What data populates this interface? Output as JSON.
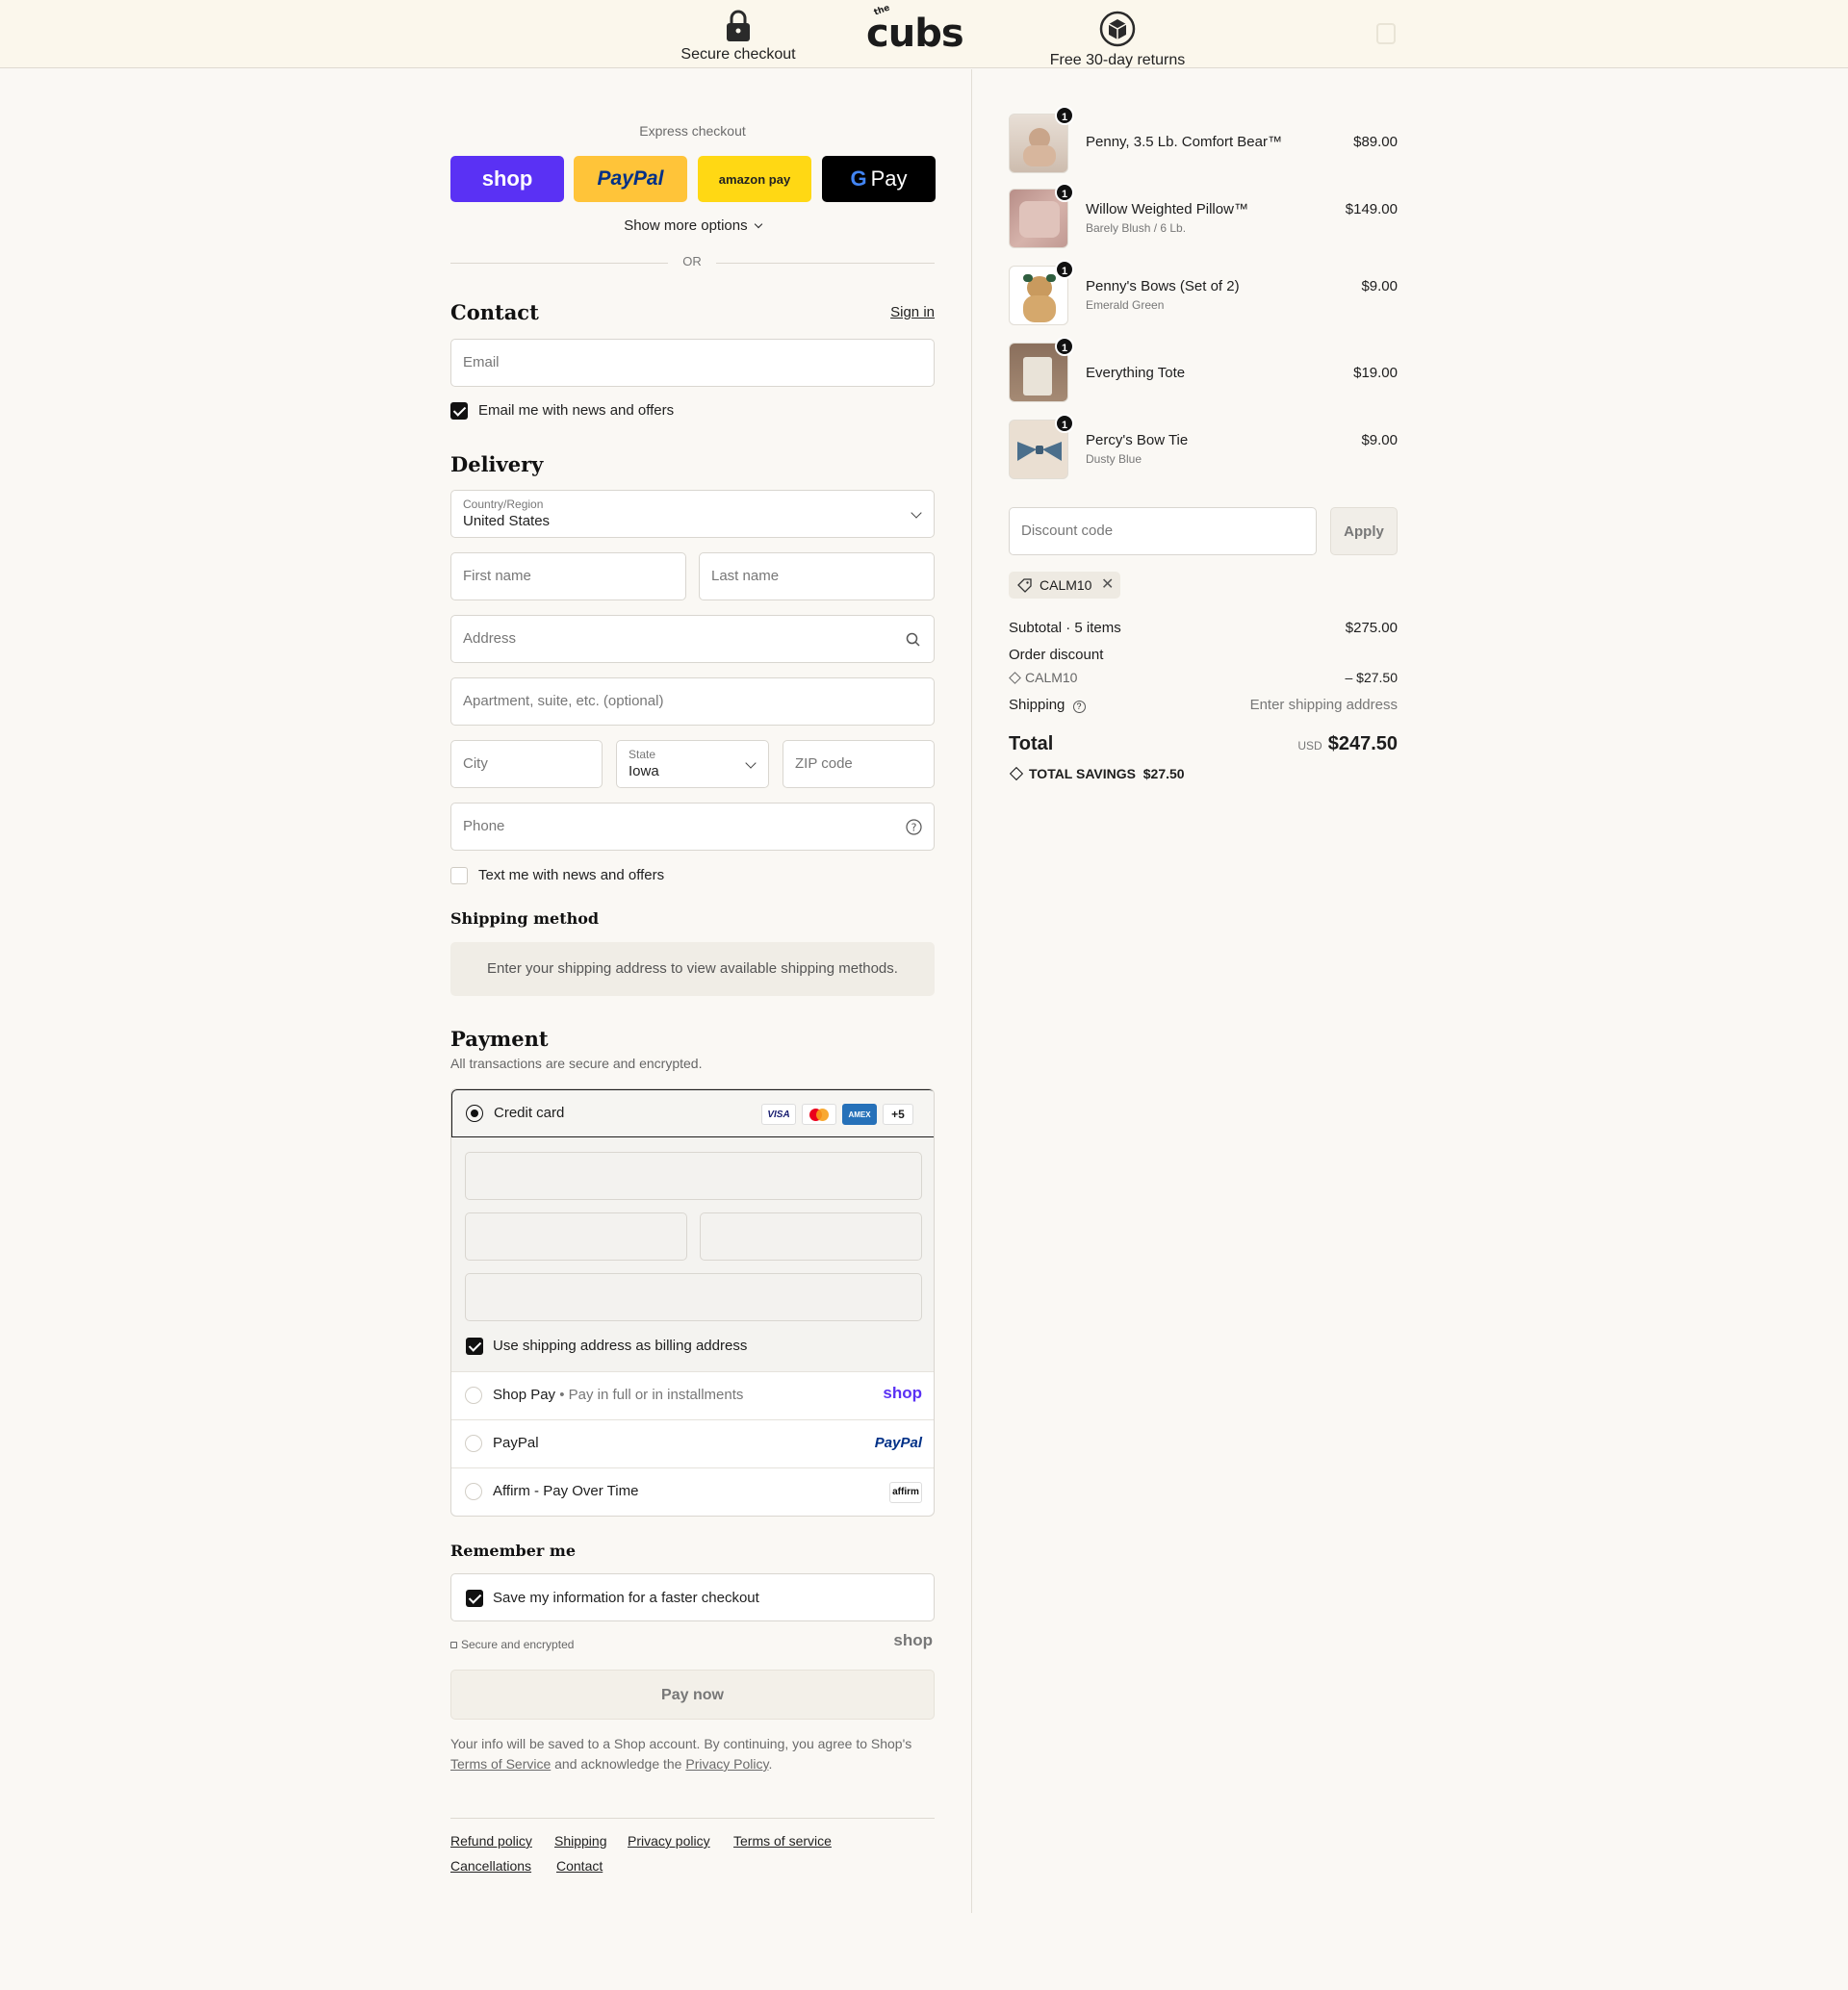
{
  "header": {
    "secure_label": "Secure checkout",
    "returns_label": "Free 30-day returns",
    "logo_text": "cubs",
    "logo_small": "the"
  },
  "express": {
    "title": "Express checkout",
    "shop_label": "shop",
    "paypal_label": "PayPal",
    "amazon_label": "amazon pay",
    "gpay_label": "Pay",
    "show_more": "Show more options",
    "or": "OR"
  },
  "contact": {
    "heading": "Contact",
    "sign_in": "Sign in",
    "email_placeholder": "Email",
    "news_label": "Email me with news and offers"
  },
  "delivery": {
    "heading": "Delivery",
    "country_label": "Country/Region",
    "country_value": "United States",
    "first_name": "First name",
    "last_name": "Last name",
    "address": "Address",
    "apartment": "Apartment, suite, etc. (optional)",
    "city": "City",
    "state_label": "State",
    "state_value": "Iowa",
    "zip": "ZIP code",
    "phone": "Phone",
    "text_label": "Text me with news and offers"
  },
  "shipping_method": {
    "heading": "Shipping method",
    "notice": "Enter your shipping address to view available shipping methods."
  },
  "payment": {
    "heading": "Payment",
    "subtitle": "All transactions are secure and encrypted.",
    "credit_card": "Credit card",
    "card_badges": [
      "VISA",
      "",
      "AMEX",
      "+5"
    ],
    "billing_label": "Use shipping address as billing address",
    "shop_pay": "Shop Pay",
    "shop_pay_sub": "Pay in full or in installments",
    "shop_pay_logo": "shop",
    "paypal": "PayPal",
    "paypal_logo": "PayPal",
    "affirm": "Affirm - Pay Over Time",
    "affirm_logo": "affirm"
  },
  "remember": {
    "heading": "Remember me",
    "save_label": "Save my information for a faster checkout",
    "secure_note": "Secure and encrypted",
    "shop_logo": "shop"
  },
  "paynow": "Pay now",
  "legal": {
    "prefix": "Your info will be saved to a Shop account. By continuing, you agree to Shop's ",
    "tos": "Terms of Service",
    "middle": " and acknowledge the ",
    "privacy": "Privacy Policy",
    "suffix": "."
  },
  "footer_links": [
    "Refund policy",
    "Shipping",
    "Privacy policy",
    "Terms of service",
    "Cancellations",
    "Contact"
  ],
  "cart": {
    "items": [
      {
        "name": "Penny, 3.5 Lb. Comfort Bear™",
        "variant": "",
        "price": "$89.00",
        "qty": "1"
      },
      {
        "name": "Willow Weighted Pillow™",
        "variant": "Barely Blush / 6 Lb.",
        "price": "$149.00",
        "qty": "1"
      },
      {
        "name": "Penny's Bows (Set of 2)",
        "variant": "Emerald Green",
        "price": "$9.00",
        "qty": "1"
      },
      {
        "name": "Everything Tote",
        "variant": "",
        "price": "$19.00",
        "qty": "1"
      },
      {
        "name": "Percy's Bow Tie",
        "variant": "Dusty Blue",
        "price": "$9.00",
        "qty": "1"
      }
    ],
    "discount_placeholder": "Discount code",
    "apply": "Apply",
    "applied_code": "CALM10",
    "subtotal_label": "Subtotal · 5 items",
    "subtotal": "$275.00",
    "order_discount": "Order discount",
    "discount_code": "CALM10",
    "discount_amount": "– $27.50",
    "shipping_label": "Shipping",
    "shipping_value": "Enter shipping address",
    "total_label": "Total",
    "currency": "USD",
    "total": "$247.50",
    "savings_label": "TOTAL SAVINGS",
    "savings": "$27.50"
  },
  "colors": {
    "shop_purple": "#5a31f4",
    "paypal_yellow": "#ffc439",
    "amazon_yellow": "#ffd814",
    "header_bg": "#fbf7ec",
    "page_bg": "#faf8f4"
  }
}
